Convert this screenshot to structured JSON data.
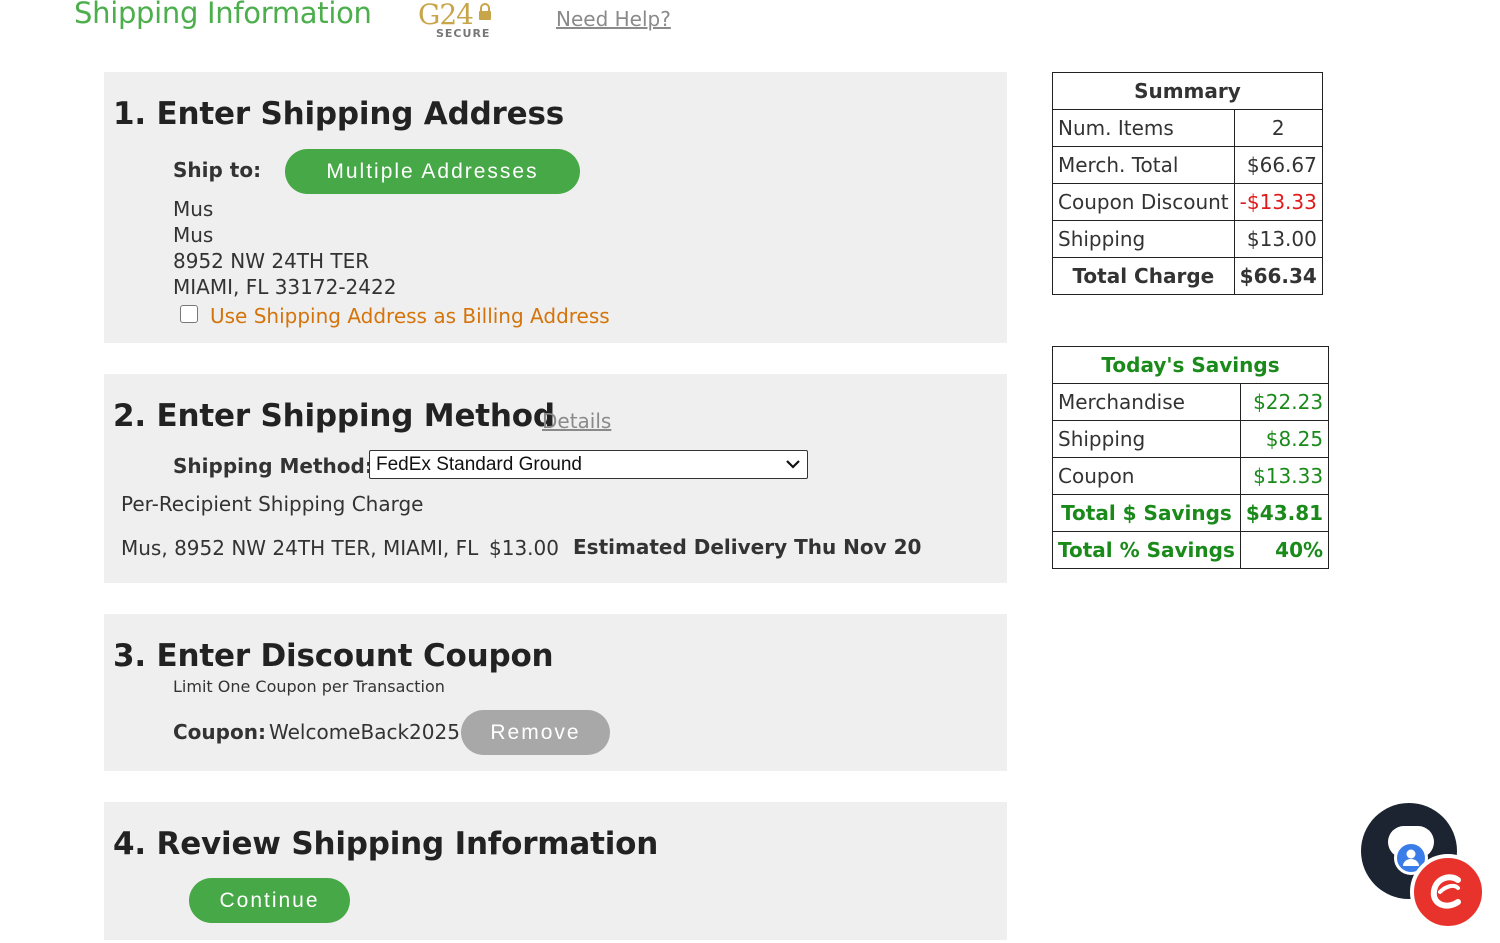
{
  "header": {
    "title": "Shipping Information",
    "logo_text": "G24",
    "logo_sub": "SECURE",
    "help_link": "Need Help?"
  },
  "section1": {
    "title": "1. Enter Shipping Address",
    "ship_to_label": "Ship to:",
    "multiple_button": "Multiple Addresses",
    "address_lines": [
      "Mus",
      "Mus",
      "8952 NW 24TH TER",
      "MIAMI, FL 33172-2422"
    ],
    "billing_checkbox_label": "Use Shipping Address as Billing Address",
    "billing_checked": false
  },
  "section2": {
    "title": "2. Enter Shipping Method",
    "details_link": "Details",
    "method_label": "Shipping Method:",
    "method_value": "FedEx Standard Ground",
    "per_recipient": "Per-Recipient Shipping Charge",
    "recipient": "Mus, 8952 NW 24TH TER, MIAMI, FL",
    "recipient_charge": "$13.00",
    "estimated_delivery": "Estimated Delivery Thu Nov 20"
  },
  "section3": {
    "title": "3. Enter Discount Coupon",
    "limit_note": "Limit One Coupon per Transaction",
    "coupon_label": "Coupon:",
    "coupon_code": "WelcomeBack2025",
    "remove_button": "Remove"
  },
  "section4": {
    "title": "4. Review Shipping Information",
    "continue_button": "Continue"
  },
  "summary": {
    "title": "Summary",
    "rows": [
      {
        "label": "Num. Items",
        "value": "2"
      },
      {
        "label": "Merch. Total",
        "value": "$66.67"
      },
      {
        "label": "Coupon Discount",
        "value": "-$13.33"
      },
      {
        "label": "Shipping",
        "value": "$13.00"
      }
    ],
    "total_label": "Total Charge",
    "total_value": "$66.34"
  },
  "savings": {
    "title": "Today's Savings",
    "rows": [
      {
        "label": "Merchandise",
        "value": "$22.23"
      },
      {
        "label": "Shipping",
        "value": "$8.25"
      },
      {
        "label": "Coupon",
        "value": "$13.33"
      }
    ],
    "total_dollar_label": "Total $ Savings",
    "total_dollar_value": "$43.81",
    "total_pct_label": "Total % Savings",
    "total_pct_value": "40%"
  },
  "colors": {
    "brand_green": "#46a846",
    "title_green": "#4cae4c",
    "savings_green": "#1a8a1a",
    "discount_red": "#e01b1b",
    "link_orange": "#d4740a",
    "section_bg": "#efefef"
  },
  "widgets": {
    "chat_icon": "chat-bot-icon",
    "support_icon": "c-logo-icon"
  }
}
